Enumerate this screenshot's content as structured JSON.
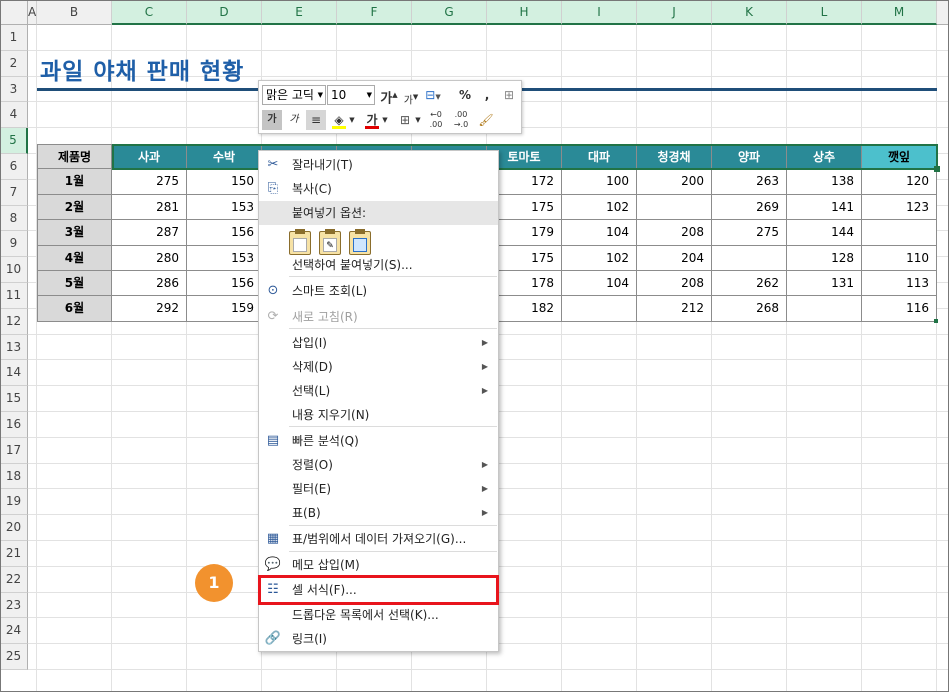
{
  "col_headers": [
    "A",
    "B",
    "C",
    "D",
    "E",
    "F",
    "G",
    "H",
    "I",
    "J",
    "K",
    "L",
    "M"
  ],
  "row_headers": [
    "1",
    "2",
    "3",
    "4",
    "5",
    "6",
    "7",
    "8",
    "9",
    "10",
    "11",
    "12",
    "13",
    "14",
    "15",
    "16",
    "17",
    "18",
    "19",
    "20",
    "21",
    "22",
    "23",
    "24",
    "25"
  ],
  "title": "과일 야채 판매 현황",
  "table": {
    "corner_header": "제품명",
    "headers": [
      "사과",
      "수박",
      "",
      "",
      "",
      "토마토",
      "대파",
      "청경채",
      "양파",
      "상추",
      "깻잎"
    ],
    "months": [
      "1월",
      "2월",
      "3월",
      "4월",
      "5월",
      "6월"
    ],
    "rows": [
      [
        "275",
        "150",
        "",
        "",
        "",
        "172",
        "100",
        "200",
        "263",
        "138",
        "120"
      ],
      [
        "281",
        "153",
        "",
        "",
        "",
        "175",
        "102",
        "",
        "269",
        "141",
        "123"
      ],
      [
        "287",
        "156",
        "",
        "",
        "",
        "179",
        "104",
        "208",
        "275",
        "144",
        ""
      ],
      [
        "280",
        "153",
        "",
        "",
        "",
        "175",
        "102",
        "204",
        "",
        "128",
        "110"
      ],
      [
        "286",
        "156",
        "",
        "",
        "",
        "178",
        "104",
        "208",
        "262",
        "131",
        "113"
      ],
      [
        "292",
        "159",
        "",
        "",
        "",
        "182",
        "",
        "212",
        "268",
        "",
        "116"
      ]
    ]
  },
  "mini_toolbar": {
    "font_name": "맑은 고딕",
    "font_size": "10",
    "percent": "%",
    "comma": ",",
    "bold": "가",
    "italic": "가",
    "font_color_glyph": "가",
    "grow_glyph": "가",
    "shrink_glyph": "가"
  },
  "menu": {
    "items": [
      {
        "label": "잘라내기(T)",
        "icon": "scissors-icon",
        "glyph": "✂"
      },
      {
        "label": "복사(C)",
        "icon": "copy-icon",
        "glyph": "⎘"
      },
      {
        "label": "붙여넣기 옵션:",
        "icon": "paste-icon",
        "glyph": "📋"
      },
      {
        "label": "선택하여 붙여넣기(S)..."
      },
      {
        "label": "스마트 조회(L)",
        "icon": "smart-lookup-icon",
        "glyph": "⊙"
      },
      {
        "label": "새로 고침(R)",
        "icon": "refresh-icon",
        "glyph": "⟳"
      },
      {
        "label": "삽입(I)"
      },
      {
        "label": "삭제(D)"
      },
      {
        "label": "선택(L)"
      },
      {
        "label": "내용 지우기(N)"
      },
      {
        "label": "빠른 분석(Q)",
        "icon": "quick-analysis-icon",
        "glyph": "▤"
      },
      {
        "label": "정렬(O)"
      },
      {
        "label": "필터(E)"
      },
      {
        "label": "표(B)"
      },
      {
        "label": "표/범위에서 데이터 가져오기(G)...",
        "icon": "table-icon",
        "glyph": "▦"
      },
      {
        "label": "메모 삽입(M)",
        "icon": "comment-icon",
        "glyph": "💬"
      },
      {
        "label": "셀 서식(F)...",
        "icon": "format-cells-icon",
        "glyph": "☷"
      },
      {
        "label": "드롭다운 목록에서 선택(K)..."
      },
      {
        "label": "링크(I)",
        "icon": "link-icon",
        "glyph": "🔗"
      }
    ]
  },
  "callout_number": "1",
  "colors": {
    "header_teal": "#2a8a97",
    "header_last": "#4cc0cc",
    "title_blue": "#1f5fa8",
    "highlight_red": "#e8141c",
    "badge_orange": "#f2922e",
    "excel_green": "#217346"
  }
}
